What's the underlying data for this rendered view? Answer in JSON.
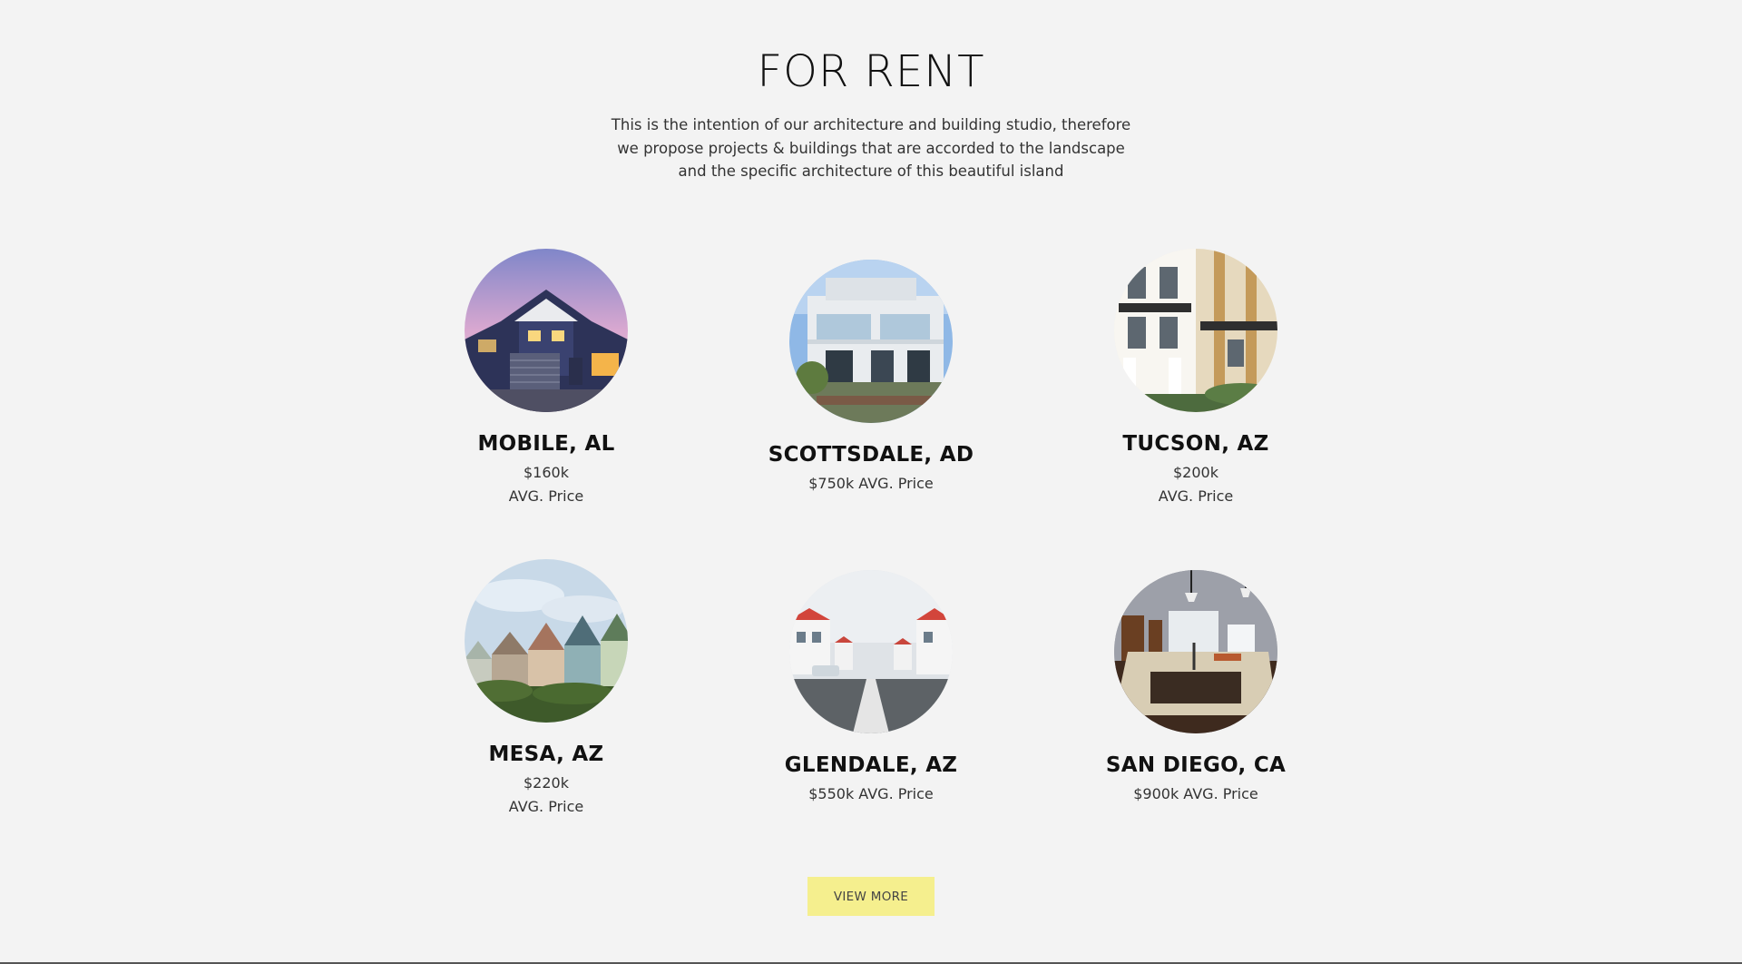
{
  "section": {
    "title": "FOR RENT",
    "intro_lines": [
      "This is the intention of our architecture and building studio, therefore",
      "we propose projects & buildings that are accorded to the landscape",
      "and the specific architecture of this beautiful island"
    ]
  },
  "listings": [
    {
      "city": "MOBILE, AL",
      "price": "$160k",
      "price_label": "AVG. Price",
      "image": "suburban-house-photo"
    },
    {
      "city": "SCOTTSDALE, AD",
      "price": "$750k",
      "price_label": "AVG. Price",
      "image": "modern-villa-photo"
    },
    {
      "city": "TUCSON, AZ",
      "price": "$200k",
      "price_label": "AVG. Price",
      "image": "townhouse-balcony-photo"
    },
    {
      "city": "MESA, AZ",
      "price": "$220k",
      "price_label": "AVG. Price",
      "image": "victorian-row-houses-photo"
    },
    {
      "city": "GLENDALE, AZ",
      "price": "$550k",
      "price_label": "AVG. Price",
      "image": "seaside-street-photo"
    },
    {
      "city": "SAN DIEGO, CA",
      "price": "$900k",
      "price_label": "AVG. Price",
      "image": "kitchen-interior-photo"
    }
  ],
  "cta": {
    "label": "VIEW MORE"
  }
}
